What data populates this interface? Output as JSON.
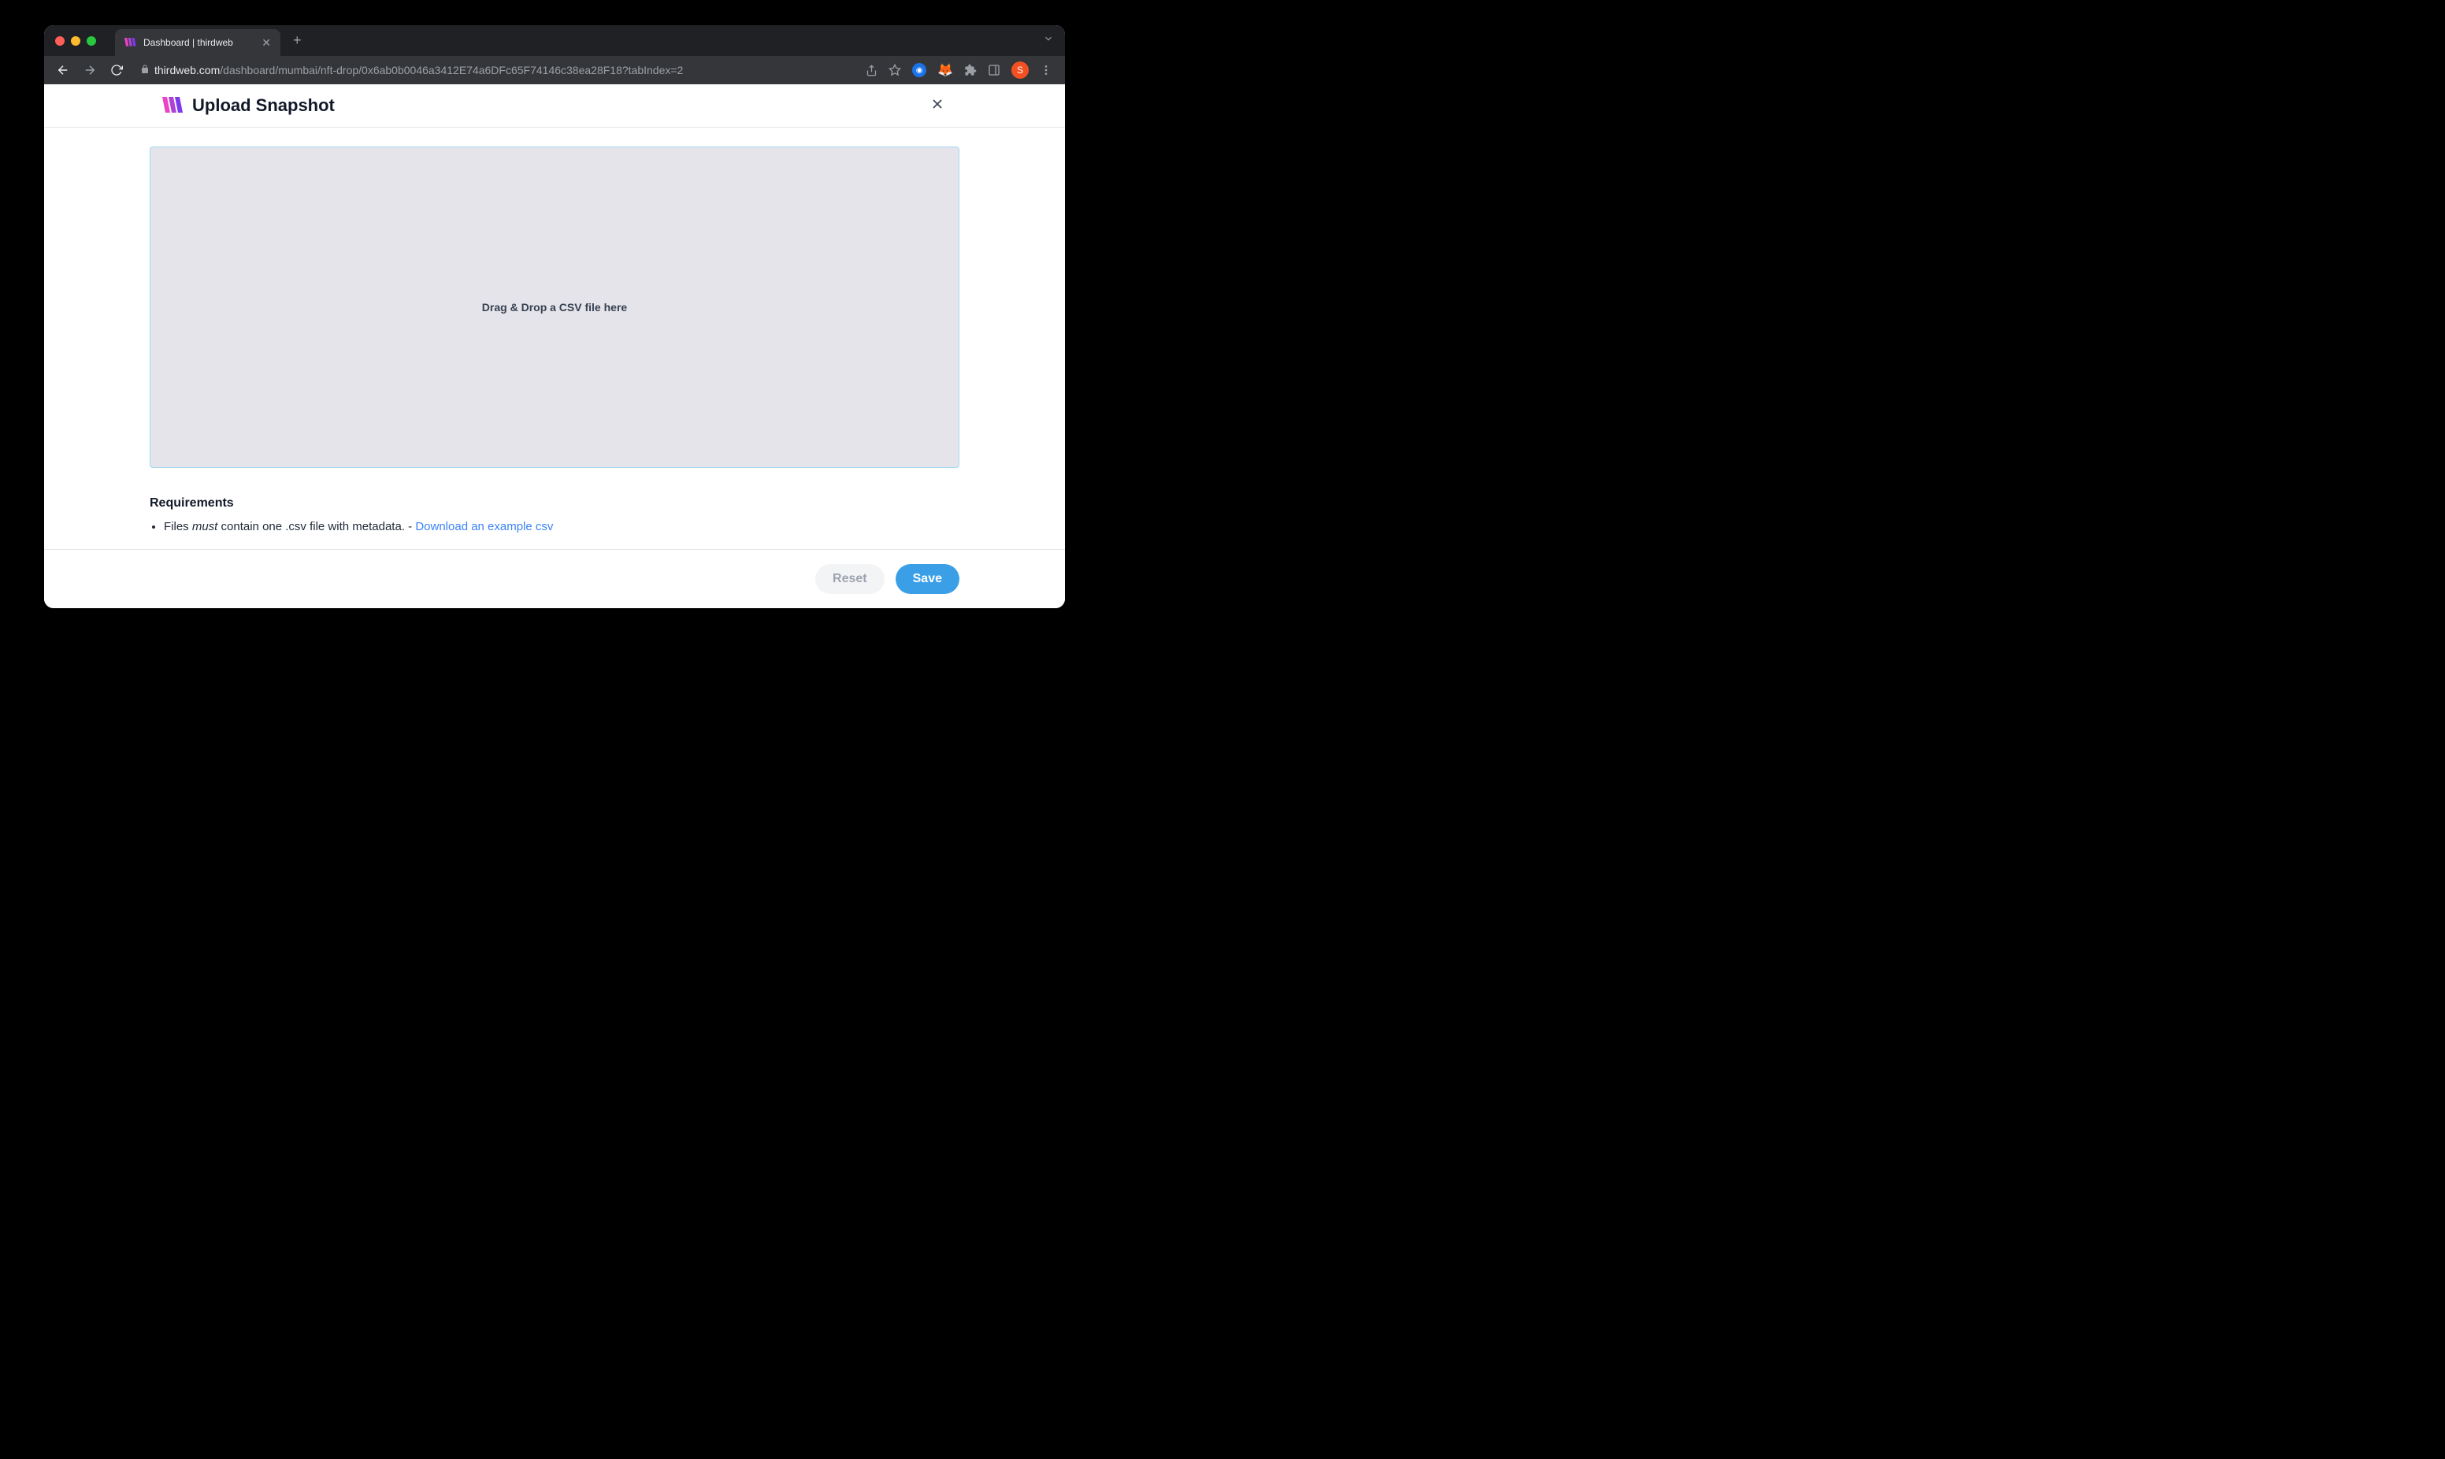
{
  "browser": {
    "tab_title": "Dashboard | thirdweb",
    "url_domain": "thirdweb.com",
    "url_path": "/dashboard/mumbai/nft-drop/0x6ab0b0046a3412E74a6DFc65F74146c38ea28F18?tabIndex=2",
    "avatar_letter": "S"
  },
  "modal": {
    "title": "Upload Snapshot",
    "dropzone_text": "Drag & Drop a CSV file here",
    "requirements_heading": "Requirements",
    "req_prefix": "Files ",
    "req_must": "must",
    "req_suffix": " contain one .csv file with metadata. - ",
    "req_link_text": "Download an example csv",
    "reset_label": "Reset",
    "save_label": "Save"
  }
}
